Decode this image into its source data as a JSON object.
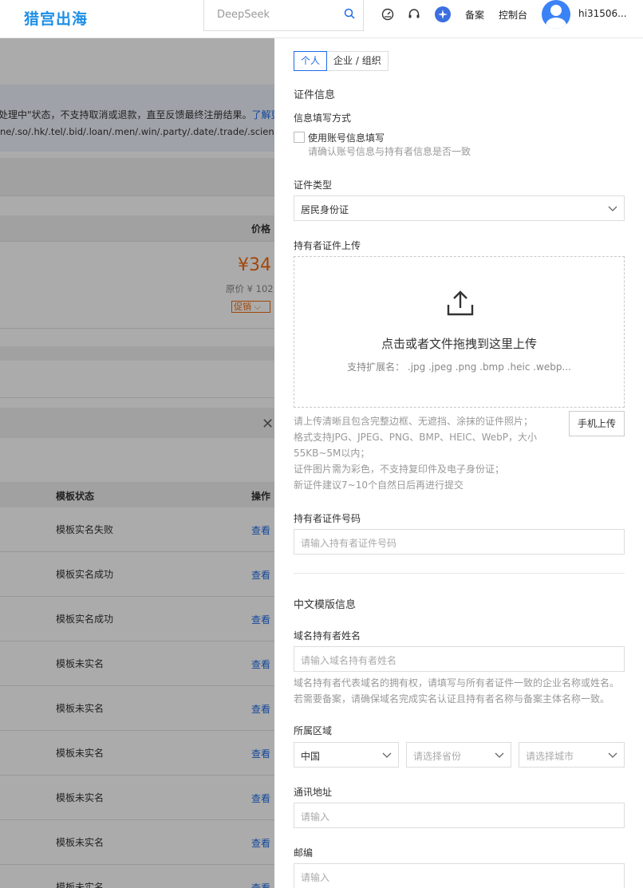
{
  "header": {
    "logo": "猎宫出海",
    "search_placeholder": "DeepSeek",
    "nav": {
      "beian": "备案",
      "console": "控制台",
      "username": "hi31506..."
    }
  },
  "background": {
    "notice_line1": "处理中\"状态，不支持取消或退款，直至反馈最终注册结果。",
    "notice_link": "了解更",
    "notice_line2": "ne/.so/.hk/.tel/.bid/.loan/.men/.win/.party/.date/.trade/.science/.clic",
    "price_header": "价格",
    "price": "¥34",
    "original_price": "原价 ¥ 102",
    "promo": "促销 ⌵",
    "table_headers": {
      "status": "模板状态",
      "action": "操作"
    },
    "rows": [
      {
        "status": "模板实名失败",
        "action": "查看"
      },
      {
        "status": "模板实名成功",
        "action": "查看"
      },
      {
        "status": "模板实名成功",
        "action": "查看"
      },
      {
        "status": "模板未实名",
        "action": "查看"
      },
      {
        "status": "模板未实名",
        "action": "查看"
      },
      {
        "status": "模板未实名",
        "action": "查看"
      },
      {
        "status": "模板未实名",
        "action": "查看"
      },
      {
        "status": "模板未实名",
        "action": "查看"
      },
      {
        "status": "模板未实名",
        "action": "查看"
      }
    ]
  },
  "drawer": {
    "tabs": [
      "个人",
      "企业 / 组织"
    ],
    "cert_section": "证件信息",
    "fill_method_label": "信息填写方式",
    "use_account_label": "使用账号信息填写",
    "use_account_hint": "请确认账号信息与持有者信息是否一致",
    "cert_type_label": "证件类型",
    "cert_type_value": "居民身份证",
    "upload_label": "持有者证件上传",
    "upload_main": "点击或者文件拖拽到这里上传",
    "upload_ext": "支持扩展名： .jpg .jpeg .png .bmp .heic .webp...",
    "upload_hints": [
      "请上传清晰且包含完整边框、无遮挡、涂抹的证件照片；",
      "格式支持JPG、JPEG、PNG、BMP、HEIC、WebP，大小",
      "55KB~5M以内；",
      "证件图片需为彩色，不支持复印件及电子身份证；",
      "新证件建议7~10个自然日后再进行提交"
    ],
    "mobile_upload": "手机上传",
    "cert_no_label": "持有者证件号码",
    "cert_no_placeholder": "请输入持有者证件号码",
    "cn_section": "中文模版信息",
    "holder_name_label": "域名持有者姓名",
    "holder_name_placeholder": "请输入域名持有者姓名",
    "holder_name_hints": [
      "域名持有者代表域名的拥有权，请填写与所有者证件一致的企业名称或姓名。",
      "若需要备案，请确保域名完成实名认证且持有者名称与备案主体名称一致。"
    ],
    "region_label": "所属区域",
    "region_country": "中国",
    "region_province_placeholder": "请选择省份",
    "region_city_placeholder": "请选择城市",
    "address_label": "通讯地址",
    "address_placeholder": "请输入",
    "zip_label": "邮编",
    "zip_placeholder": "请输入"
  }
}
